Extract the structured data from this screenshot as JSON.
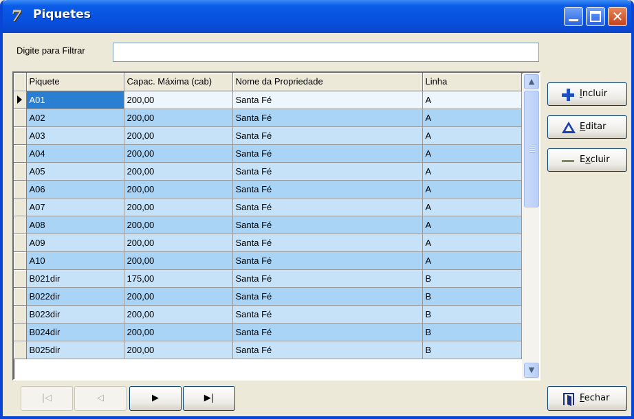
{
  "window": {
    "title": "Piquetes",
    "app_icon_glyph": "7"
  },
  "filter": {
    "label": "Digite para Filtrar",
    "value": "",
    "placeholder": ""
  },
  "grid": {
    "columns": [
      "Piquete",
      "Capac. Máxima (cab)",
      "Nome da Propriedade",
      "Linha"
    ],
    "rows": [
      [
        "A01",
        "200,00",
        "Santa Fé",
        "A"
      ],
      [
        "A02",
        "200,00",
        "Santa Fé",
        "A"
      ],
      [
        "A03",
        "200,00",
        "Santa Fé",
        "A"
      ],
      [
        "A04",
        "200,00",
        "Santa Fé",
        "A"
      ],
      [
        "A05",
        "200,00",
        "Santa Fé",
        "A"
      ],
      [
        "A06",
        "200,00",
        "Santa Fé",
        "A"
      ],
      [
        "A07",
        "200,00",
        "Santa Fé",
        "A"
      ],
      [
        "A08",
        "200,00",
        "Santa Fé",
        "A"
      ],
      [
        "A09",
        "200,00",
        "Santa Fé",
        "A"
      ],
      [
        "A10",
        "200,00",
        "Santa Fé",
        "A"
      ],
      [
        "B021dir",
        "175,00",
        "Santa Fé",
        "B"
      ],
      [
        "B022dir",
        "200,00",
        "Santa Fé",
        "B"
      ],
      [
        "B023dir",
        "200,00",
        "Santa Fé",
        "B"
      ],
      [
        "B024dir",
        "200,00",
        "Santa Fé",
        "B"
      ],
      [
        "B025dir",
        "200,00",
        "Santa Fé",
        "B"
      ]
    ],
    "selected_row": 0
  },
  "actions": {
    "incluir": {
      "first": "I",
      "rest": "ncluir"
    },
    "editar": {
      "first": "E",
      "rest": "ditar"
    },
    "excluir": {
      "first": "E",
      "mid": "x",
      "rest": "cluir"
    }
  },
  "nav": {
    "first": "|◁",
    "prev": "◁",
    "next": "▶",
    "last": "▶|"
  },
  "close_button": {
    "first": "F",
    "rest": "echar"
  }
}
